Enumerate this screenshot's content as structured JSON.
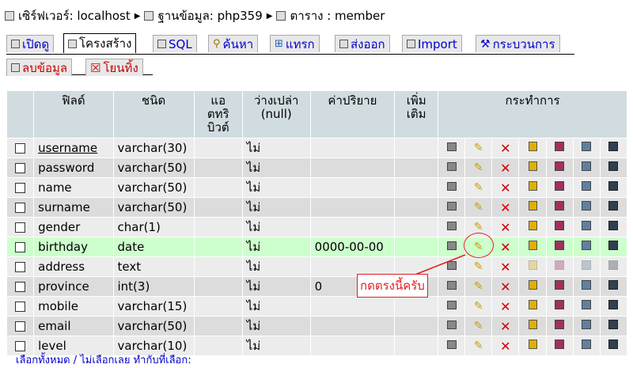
{
  "breadcrumb": {
    "server": "เซิร์ฟเวอร์: localhost",
    "database": "ฐานข้อมูล: php359",
    "table": "ตาราง : member"
  },
  "tabs": [
    {
      "label": "เปิดดู"
    },
    {
      "label": "โครงสร้าง"
    },
    {
      "label": "SQL"
    },
    {
      "label": "ค้นหา"
    },
    {
      "label": "แทรก"
    },
    {
      "label": "ส่งออก"
    },
    {
      "label": "Import"
    },
    {
      "label": "กระบวนการ"
    }
  ],
  "tabs2": [
    {
      "label": "ลบข้อมูล"
    },
    {
      "label": "โยนทิ้ง"
    }
  ],
  "table": {
    "headers": {
      "field": "ฟิลด์",
      "type": "ชนิด",
      "attr_l1": "แอ",
      "attr_l2": "ตทริ",
      "attr_l3": "บิวต์",
      "null_l1": "ว่างเปล่า",
      "null_l2": "(null)",
      "default": "ค่าปริยาย",
      "extra_l1": "เพิ่ม",
      "extra_l2": "เติม",
      "action": "กระทำการ"
    },
    "rows": [
      {
        "field": "username",
        "type": "varchar(30)",
        "null": "ไม่",
        "default": ""
      },
      {
        "field": "password",
        "type": "varchar(50)",
        "null": "ไม่",
        "default": ""
      },
      {
        "field": "name",
        "type": "varchar(50)",
        "null": "ไม่",
        "default": ""
      },
      {
        "field": "surname",
        "type": "varchar(50)",
        "null": "ไม่",
        "default": ""
      },
      {
        "field": "gender",
        "type": "char(1)",
        "null": "ไม่",
        "default": ""
      },
      {
        "field": "birthday",
        "type": "date",
        "null": "ไม่",
        "default": "0000-00-00"
      },
      {
        "field": "address",
        "type": "text",
        "null": "ไม่",
        "default": ""
      },
      {
        "field": "province",
        "type": "int(3)",
        "null": "ไม่",
        "default": "0"
      },
      {
        "field": "mobile",
        "type": "varchar(15)",
        "null": "ไม่",
        "default": ""
      },
      {
        "field": "email",
        "type": "varchar(50)",
        "null": "ไม่",
        "default": ""
      },
      {
        "field": "level",
        "type": "varchar(10)",
        "null": "ไม่",
        "default": ""
      }
    ]
  },
  "annotation": "กดตรงนี้ครับ",
  "footer": "เลือกทั้งหมด / ไม่เลือกเลย ทำกับที่เลือก:",
  "colors": {
    "accent": "#0000cc",
    "annotation": "#e02020",
    "header_bg": "#d0dce0",
    "highlight_row": "#ccffcc"
  },
  "icons": [
    "server-icon",
    "database-icon",
    "table-icon",
    "browse-icon",
    "structure-icon",
    "sql-icon",
    "search-icon",
    "insert-icon",
    "export-icon",
    "import-icon",
    "operations-icon",
    "empty-icon",
    "drop-icon",
    "edit-icon",
    "delete-icon",
    "primary-key-icon",
    "unique-icon",
    "index-icon",
    "fulltext-icon"
  ]
}
